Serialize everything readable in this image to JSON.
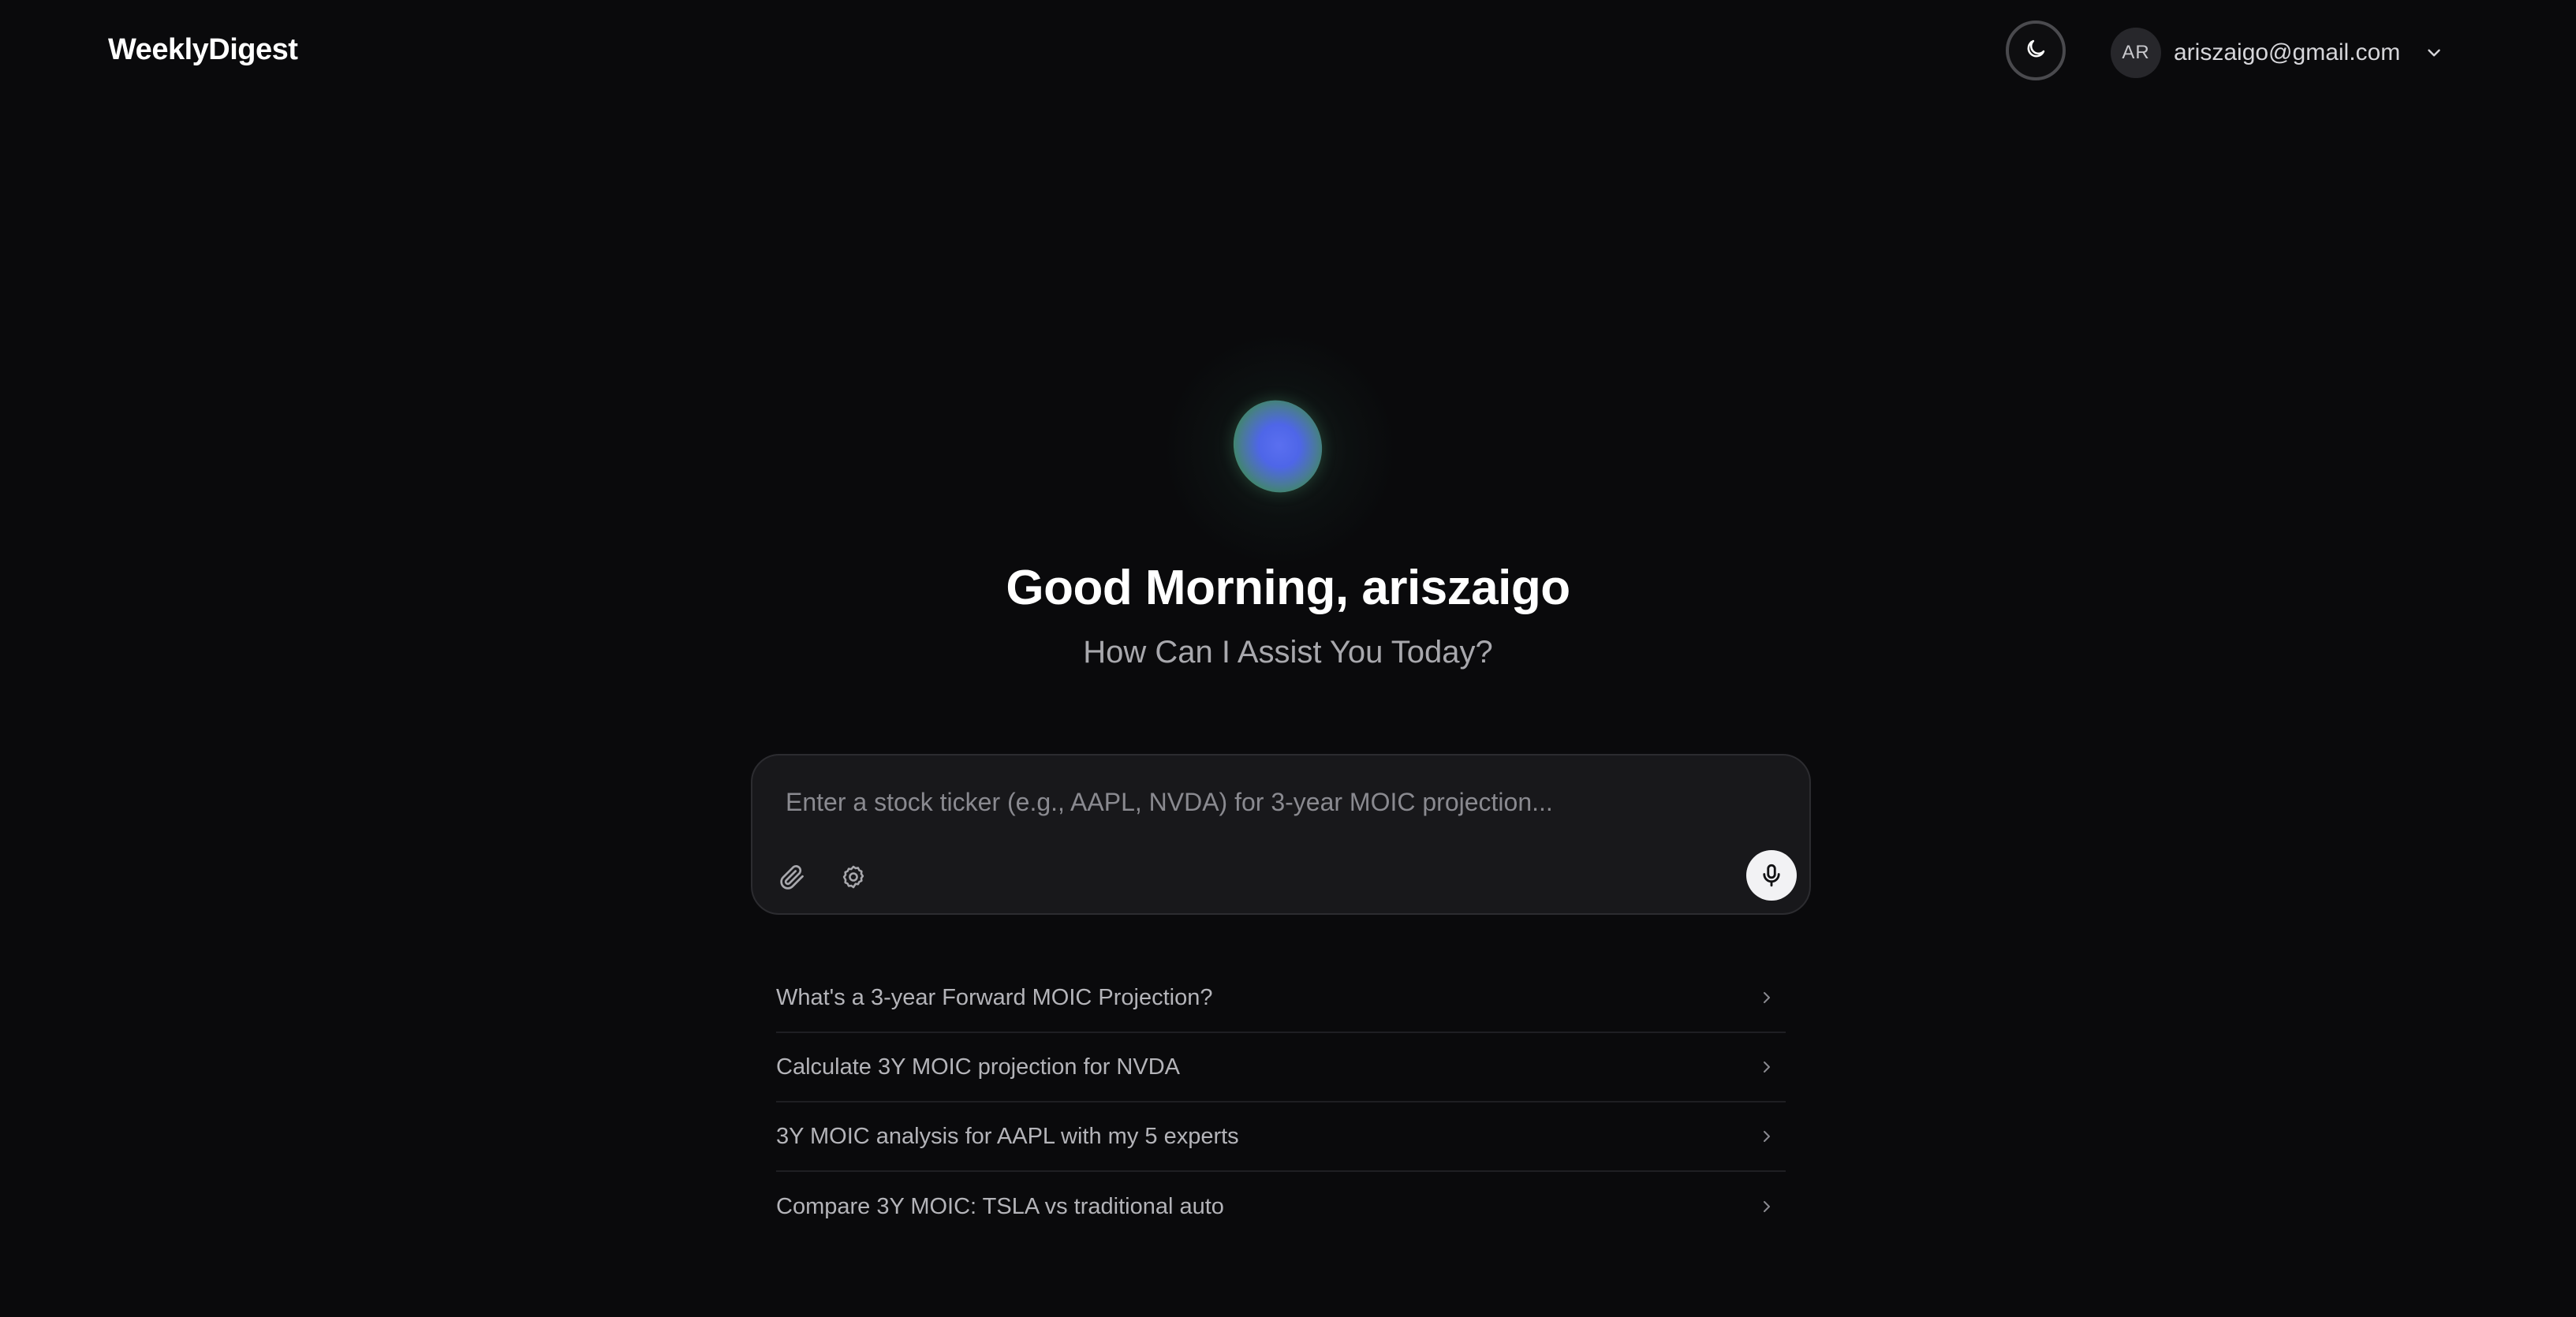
{
  "header": {
    "brand": "WeeklyDigest",
    "theme_toggle_icon": "moon-icon",
    "account": {
      "initials": "AR",
      "email": "ariszaigo@gmail.com",
      "dropdown_icon": "chevron-down-icon"
    }
  },
  "hero": {
    "greeting": "Good Morning, ariszaigo",
    "subtitle": "How Can I Assist You Today?",
    "orb_colors": [
      "#4e66e8",
      "#3c8a5c"
    ]
  },
  "composer": {
    "placeholder": "Enter a stock ticker (e.g., AAPL, NVDA) for 3-year MOIC projection...",
    "value": "",
    "tools": [
      "paperclip-icon",
      "settings-icon"
    ],
    "mic_icon": "microphone-icon"
  },
  "suggestions": [
    {
      "label": "What's a 3-year Forward MOIC Projection?"
    },
    {
      "label": "Calculate 3Y MOIC projection for NVDA"
    },
    {
      "label": "3Y MOIC analysis for AAPL with my 5 experts"
    },
    {
      "label": "Compare 3Y MOIC: TSLA vs traditional auto"
    }
  ],
  "colors": {
    "background": "#0a0a0c",
    "composer_bg": "#18181b",
    "muted_text": "#a8a8ad"
  }
}
